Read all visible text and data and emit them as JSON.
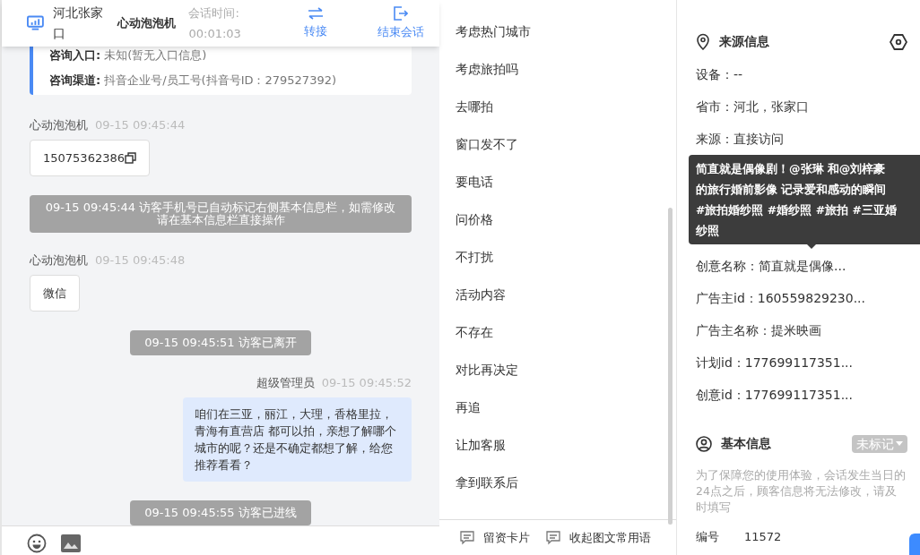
{
  "header": {
    "location": "河北张家口",
    "visitor": "心动泡泡机",
    "timer_label": "会话时间:",
    "timer": "00:01:03",
    "actions": [
      {
        "kind": "transfer",
        "label": "转接"
      },
      {
        "kind": "end",
        "label": "结束会话"
      }
    ]
  },
  "info_card": [
    {
      "label": "咨询入口:",
      "value": "未知(暂无入口信息)"
    },
    {
      "label": "咨询渠道:",
      "value": "抖音企业号/员工号(抖音号ID：279527392)"
    }
  ],
  "messages": [
    {
      "kind": "visitor",
      "sender": "心动泡泡机",
      "time": "09-15 09:45:44",
      "text": "15075362386",
      "copyable": true
    },
    {
      "kind": "system",
      "text": "09-15 09:45:44 访客手机号已自动标记右侧基本信息栏，如需修改请在基本信息栏直接操作"
    },
    {
      "kind": "visitor",
      "sender": "心动泡泡机",
      "time": "09-15 09:45:48",
      "text": "微信",
      "copyable": false
    },
    {
      "kind": "system",
      "text": "09-15 09:45:51 访客已离开"
    },
    {
      "kind": "agent",
      "sender": "超级管理员",
      "time": "09-15 09:45:52",
      "text": "咱们在三亚，丽江，大理，香格里拉，青海有直营店 都可以拍，亲想了解哪个城市的呢？还是不确定都想了解，给您推荐看看？"
    },
    {
      "kind": "system",
      "text": "09-15 09:45:55 访客已进线"
    }
  ],
  "phrases": [
    "考虑热门城市",
    "考虑旅拍吗",
    "去哪拍",
    "窗口发不了",
    "要电话",
    "问价格",
    "不打扰",
    "活动内容",
    "不存在",
    "对比再决定",
    "再追",
    "让加客服",
    "拿到联系后"
  ],
  "bottom_actions": [
    {
      "label": "留资卡片"
    },
    {
      "label": "收起图文常用语"
    }
  ],
  "source": {
    "title": "来源信息",
    "rows_top": [
      "设备：--",
      "省市：河北，张家口",
      "来源：直接访问"
    ],
    "tooltip": [
      "简直就是偶像剧！@张琳 和@刘梓豪",
      "的旅行婚前影像 记录爱和感动的瞬间",
      "#旅拍婚纱照 #婚纱照 #旅拍 #三亚婚",
      "纱照"
    ],
    "rows_bottom": [
      "创意名称：简直就是偶像...",
      "广告主id：160559829230...",
      "广告主名称：提米映画",
      "计划id：177699117351...",
      "创意id：177699117351..."
    ]
  },
  "basic": {
    "title": "基本信息",
    "tag": "未标记",
    "note": "为了保障您的使用体验，会话发生当日的24点之后，顾客信息将无法修改，请及时填写",
    "fields": [
      {
        "label": "编号",
        "value": "11572"
      }
    ]
  }
}
